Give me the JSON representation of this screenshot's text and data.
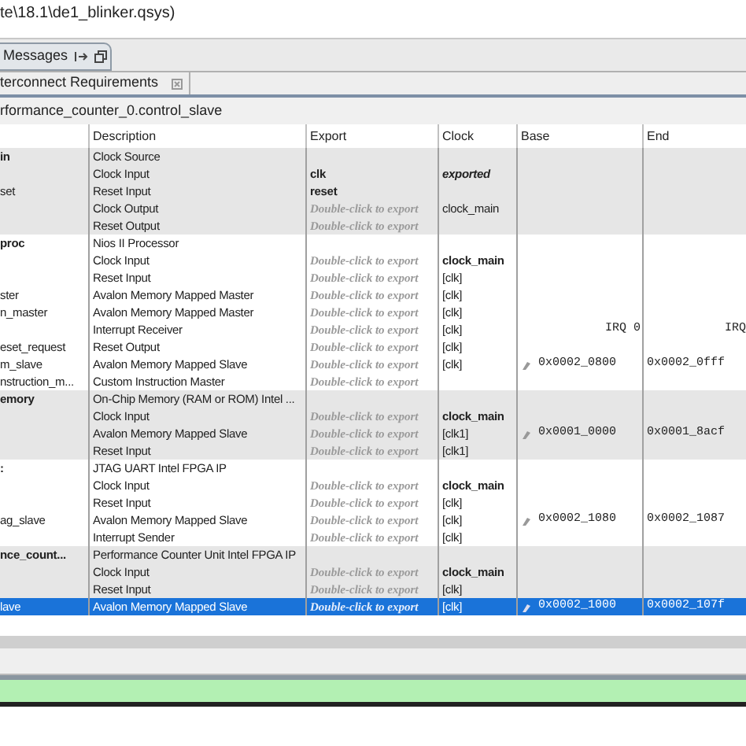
{
  "window": {
    "title": "te\\18.1\\de1_blinker.qsys)"
  },
  "tabs": [
    {
      "label": "Messages",
      "selected": false
    }
  ],
  "panel": {
    "tab": {
      "label": "terconnect Requirements"
    },
    "path": "rformance_counter_0.control_slave"
  },
  "table": {
    "columns": [
      "",
      "Description",
      "Export",
      "Clock",
      "Base",
      "End"
    ],
    "rows": [
      {
        "kind": "module",
        "name": "in",
        "description": "Clock Source",
        "shaded": true,
        "selected": false
      },
      {
        "kind": "interface",
        "name": "",
        "description": "Clock Input",
        "export": "clk",
        "clock": "exported",
        "exported": true,
        "connected": false,
        "shaded": true,
        "selected": false
      },
      {
        "kind": "interface",
        "name": "set",
        "description": "Reset Input",
        "export": "reset",
        "shaded": true,
        "selected": false
      },
      {
        "kind": "interface",
        "name": "",
        "description": "Clock Output",
        "export_placeholder": "Double-click to export",
        "clock": "clock_main",
        "exported": false,
        "connected": false,
        "shaded": true,
        "selected": false
      },
      {
        "kind": "interface",
        "name": "",
        "description": "Reset Output",
        "export_placeholder": "Double-click to export",
        "shaded": true,
        "selected": false
      },
      {
        "kind": "module",
        "name": "proc",
        "description": "Nios II Processor",
        "shaded": false,
        "selected": false
      },
      {
        "kind": "interface",
        "name": "",
        "description": "Clock Input",
        "export_placeholder": "Double-click to export",
        "clock": "clock_main",
        "exported": false,
        "connected": true,
        "shaded": false,
        "selected": false
      },
      {
        "kind": "interface",
        "name": "",
        "description": "Reset Input",
        "export_placeholder": "Double-click to export",
        "clock": "[clk]",
        "exported": false,
        "connected": false,
        "shaded": false,
        "selected": false
      },
      {
        "kind": "interface",
        "name": "ster",
        "description": "Avalon Memory Mapped Master",
        "export_placeholder": "Double-click to export",
        "clock": "[clk]",
        "exported": false,
        "connected": false,
        "shaded": false,
        "selected": false
      },
      {
        "kind": "interface",
        "name": "n_master",
        "description": "Avalon Memory Mapped Master",
        "export_placeholder": "Double-click to export",
        "clock": "[clk]",
        "exported": false,
        "connected": false,
        "shaded": false,
        "selected": false
      },
      {
        "kind": "interface",
        "name": "",
        "description": "Interrupt Receiver",
        "export_placeholder": "Double-click to export",
        "clock": "[clk]",
        "exported": false,
        "connected": false,
        "irq_base": "IRQ 0",
        "irq_end": "IRQ",
        "shaded": false,
        "selected": false
      },
      {
        "kind": "interface",
        "name": "eset_request",
        "description": "Reset Output",
        "export_placeholder": "Double-click to export",
        "clock": "[clk]",
        "exported": false,
        "connected": false,
        "shaded": false,
        "selected": false
      },
      {
        "kind": "interface",
        "name": "m_slave",
        "description": "Avalon Memory Mapped Slave",
        "export_placeholder": "Double-click to export",
        "clock": "[clk]",
        "exported": false,
        "connected": false,
        "base": "0x0002_0800",
        "end": "0x0002_0fff",
        "shaded": false,
        "selected": false
      },
      {
        "kind": "interface",
        "name": "nstruction_m...",
        "description": "Custom Instruction Master",
        "export_placeholder": "Double-click to export",
        "shaded": false,
        "selected": false
      },
      {
        "kind": "module",
        "name": "emory",
        "description": "On-Chip Memory (RAM or ROM) Intel ...",
        "shaded": true,
        "selected": false
      },
      {
        "kind": "interface",
        "name": "",
        "description": "Clock Input",
        "export_placeholder": "Double-click to export",
        "clock": "clock_main",
        "exported": false,
        "connected": true,
        "shaded": true,
        "selected": false
      },
      {
        "kind": "interface",
        "name": "",
        "description": "Avalon Memory Mapped Slave",
        "export_placeholder": "Double-click to export",
        "clock": "[clk1]",
        "exported": false,
        "connected": false,
        "base": "0x0001_0000",
        "end": "0x0001_8acf",
        "shaded": true,
        "selected": false
      },
      {
        "kind": "interface",
        "name": "",
        "description": "Reset Input",
        "export_placeholder": "Double-click to export",
        "clock": "[clk1]",
        "exported": false,
        "connected": false,
        "shaded": true,
        "selected": false
      },
      {
        "kind": "module",
        "name": ":",
        "description": "JTAG UART Intel FPGA IP",
        "shaded": false,
        "selected": false
      },
      {
        "kind": "interface",
        "name": "",
        "description": "Clock Input",
        "export_placeholder": "Double-click to export",
        "clock": "clock_main",
        "exported": false,
        "connected": true,
        "shaded": false,
        "selected": false
      },
      {
        "kind": "interface",
        "name": "",
        "description": "Reset Input",
        "export_placeholder": "Double-click to export",
        "clock": "[clk]",
        "exported": false,
        "connected": false,
        "shaded": false,
        "selected": false
      },
      {
        "kind": "interface",
        "name": "ag_slave",
        "description": "Avalon Memory Mapped Slave",
        "export_placeholder": "Double-click to export",
        "clock": "[clk]",
        "exported": false,
        "connected": false,
        "base": "0x0002_1080",
        "end": "0x0002_1087",
        "shaded": false,
        "selected": false
      },
      {
        "kind": "interface",
        "name": "",
        "description": "Interrupt Sender",
        "export_placeholder": "Double-click to export",
        "clock": "[clk]",
        "exported": false,
        "connected": false,
        "shaded": false,
        "selected": false
      },
      {
        "kind": "module",
        "name": "nce_count...",
        "description": "Performance Counter Unit Intel FPGA IP",
        "shaded": true,
        "selected": false
      },
      {
        "kind": "interface",
        "name": "",
        "description": "Clock Input",
        "export_placeholder": "Double-click to export",
        "clock": "clock_main",
        "exported": false,
        "connected": true,
        "shaded": true,
        "selected": false
      },
      {
        "kind": "interface",
        "name": "",
        "description": "Reset Input",
        "export_placeholder": "Double-click to export",
        "clock": "[clk]",
        "exported": false,
        "connected": false,
        "shaded": true,
        "selected": false
      },
      {
        "kind": "interface",
        "name": "lave",
        "description": "Avalon Memory Mapped Slave",
        "export_placeholder": "Double-click to export",
        "clock": "[clk]",
        "exported": false,
        "connected": false,
        "base": "0x0002_1000",
        "end": "0x0002_107f",
        "selected": true
      }
    ]
  }
}
